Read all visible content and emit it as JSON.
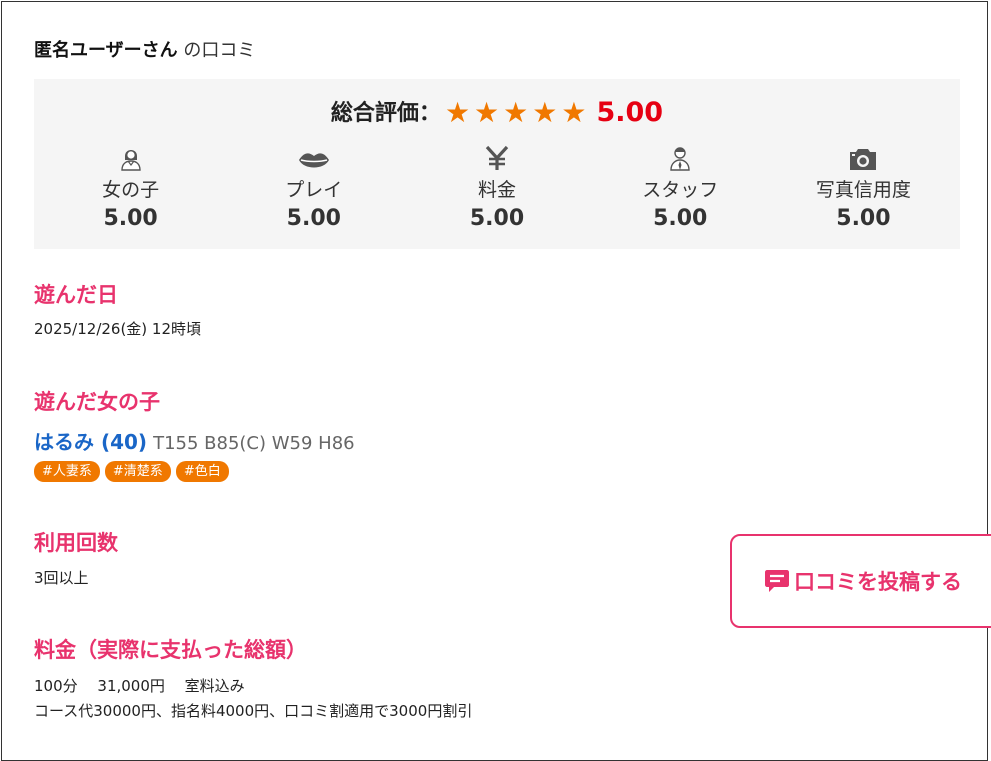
{
  "reviewer": {
    "name": "匿名ユーザーさん",
    "suffix": " の口コミ"
  },
  "overall": {
    "label": "総合評価：",
    "stars": "★★★★★",
    "score": "5.00"
  },
  "categories": [
    {
      "icon": "girl-icon",
      "label": "女の子",
      "value": "5.00"
    },
    {
      "icon": "lips-icon",
      "label": "プレイ",
      "value": "5.00"
    },
    {
      "icon": "yen-icon",
      "label": "料金",
      "value": "5.00"
    },
    {
      "icon": "staff-icon",
      "label": "スタッフ",
      "value": "5.00"
    },
    {
      "icon": "camera-icon",
      "label": "写真信用度",
      "value": "5.00"
    }
  ],
  "visit_date": {
    "heading": "遊んだ日",
    "value": "2025/12/26(金) 12時頃"
  },
  "girl": {
    "heading": "遊んだ女の子",
    "name": "はるみ (40)",
    "measurements": "T155 B85(C) W59 H86",
    "tags": [
      "#人妻系",
      "#清楚系",
      "#色白"
    ]
  },
  "usage": {
    "heading": "利用回数",
    "value": "3回以上"
  },
  "price": {
    "heading": "料金（実際に支払った総額）",
    "line1": "100分　 31,000円　 室料込み",
    "line2": "コース代30000円、指名料4000円、口コミ割適用で3000円割引"
  },
  "post_button": {
    "label": "口コミを投稿する"
  },
  "colors": {
    "accent": "#e8336d",
    "star": "#f07800",
    "score": "#e60012",
    "link": "#1a66c7",
    "tag": "#f07800"
  }
}
